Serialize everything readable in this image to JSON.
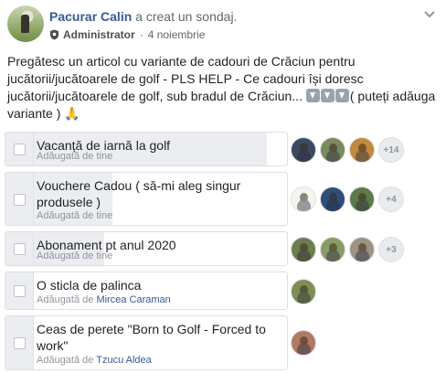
{
  "post": {
    "author": "Pacurar Calin",
    "action": "a creat un sondaj.",
    "role": "Administrator",
    "date": "4 noiembrie",
    "text": "Pregătesc un articol cu variante de cadouri de Crăciun pentru jucătorii/jucătoarele de golf - PLS HELP - Ce cadouri își doresc jucătorii/jucătoarele de golf, sub bradul de Crăciun... ",
    "text_tail": "( puteți adăuga variante ) 🙏"
  },
  "icons": {
    "role": "shield-icon",
    "menu": "chevron-down-icon",
    "emoji_down": "down-arrow-emoji"
  },
  "colors": {
    "link": "#385898",
    "fill": "#ebedf0",
    "border": "#dddfe2"
  },
  "poll": {
    "added_prefix": "Adăugată de",
    "options": [
      {
        "label": "Vacanță de iarnă la golf",
        "added": "Adăugată de tine",
        "added_by": "",
        "fill_fraction": 0.93,
        "more": "+14"
      },
      {
        "label": "Vouchere Cadou ( să-mi aleg singur produsele )",
        "added": "Adăugată de tine",
        "added_by": "",
        "fill_fraction": 0.38,
        "more": "+4"
      },
      {
        "label": "Abonament pt anul 2020",
        "added": "Adăugată de tine",
        "added_by": "",
        "fill_fraction": 0.35,
        "more": "+3"
      },
      {
        "label": "O sticla de palinca",
        "added": "Adăugată de",
        "added_by": "Mircea Caraman",
        "fill_fraction": 0.1,
        "more": ""
      },
      {
        "label": "Ceas de perete \"Born to Golf - Forced to work\"",
        "added": "Adăugată de",
        "added_by": "Tzucu Aldea",
        "fill_fraction": 0.1,
        "more": ""
      }
    ]
  }
}
